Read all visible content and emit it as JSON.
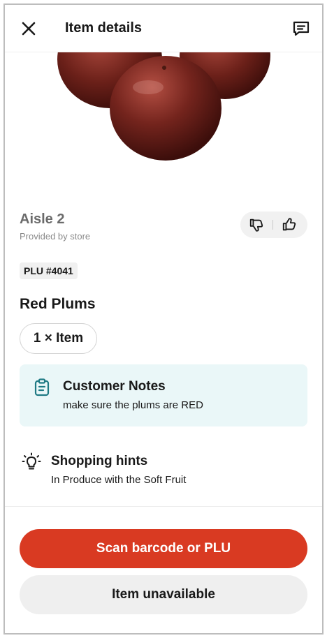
{
  "header": {
    "title": "Item details",
    "close_icon": "close-icon",
    "chat_icon": "chat-icon"
  },
  "product": {
    "image_description_icon": "plums-image"
  },
  "aisle": {
    "title": "Aisle 2",
    "subtitle": "Provided by store"
  },
  "feedback": {
    "thumbs_down_icon": "thumbs-down-icon",
    "thumbs_up_icon": "thumbs-up-icon"
  },
  "item": {
    "plu": "PLU #4041",
    "name": "Red Plums",
    "quantity": "1 × Item"
  },
  "customer_notes": {
    "title": "Customer Notes",
    "text": "make sure the plums are RED",
    "icon": "clipboard-icon"
  },
  "shopping_hints": {
    "title": "Shopping hints",
    "text": "In Produce with the Soft Fruit",
    "icon": "lightbulb-icon"
  },
  "actions": {
    "scan_label": "Scan barcode or PLU",
    "unavailable_label": "Item unavailable"
  },
  "colors": {
    "primary": "#d93a22",
    "notes_bg": "#eaf7f8",
    "notes_icon": "#1f7a84"
  }
}
